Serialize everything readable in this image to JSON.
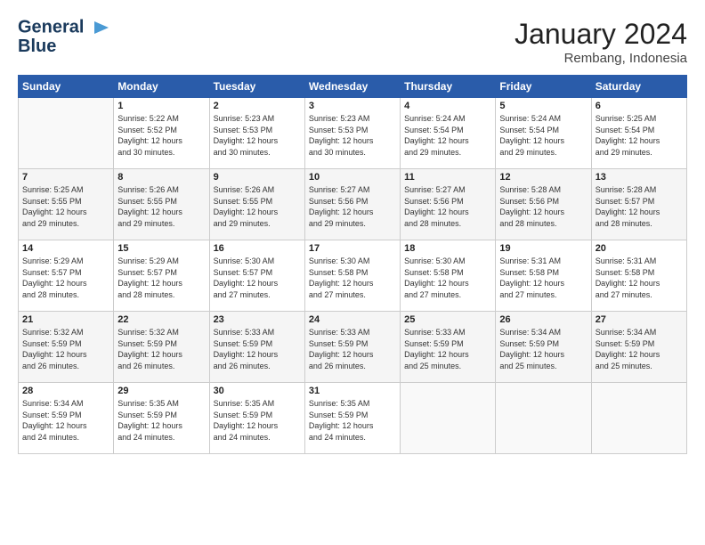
{
  "header": {
    "logo_line1": "General",
    "logo_line2": "Blue",
    "month_year": "January 2024",
    "location": "Rembang, Indonesia"
  },
  "days_of_week": [
    "Sunday",
    "Monday",
    "Tuesday",
    "Wednesday",
    "Thursday",
    "Friday",
    "Saturday"
  ],
  "weeks": [
    [
      {
        "day": "",
        "info": ""
      },
      {
        "day": "1",
        "info": "Sunrise: 5:22 AM\nSunset: 5:52 PM\nDaylight: 12 hours\nand 30 minutes."
      },
      {
        "day": "2",
        "info": "Sunrise: 5:23 AM\nSunset: 5:53 PM\nDaylight: 12 hours\nand 30 minutes."
      },
      {
        "day": "3",
        "info": "Sunrise: 5:23 AM\nSunset: 5:53 PM\nDaylight: 12 hours\nand 30 minutes."
      },
      {
        "day": "4",
        "info": "Sunrise: 5:24 AM\nSunset: 5:54 PM\nDaylight: 12 hours\nand 29 minutes."
      },
      {
        "day": "5",
        "info": "Sunrise: 5:24 AM\nSunset: 5:54 PM\nDaylight: 12 hours\nand 29 minutes."
      },
      {
        "day": "6",
        "info": "Sunrise: 5:25 AM\nSunset: 5:54 PM\nDaylight: 12 hours\nand 29 minutes."
      }
    ],
    [
      {
        "day": "7",
        "info": "Sunrise: 5:25 AM\nSunset: 5:55 PM\nDaylight: 12 hours\nand 29 minutes."
      },
      {
        "day": "8",
        "info": "Sunrise: 5:26 AM\nSunset: 5:55 PM\nDaylight: 12 hours\nand 29 minutes."
      },
      {
        "day": "9",
        "info": "Sunrise: 5:26 AM\nSunset: 5:55 PM\nDaylight: 12 hours\nand 29 minutes."
      },
      {
        "day": "10",
        "info": "Sunrise: 5:27 AM\nSunset: 5:56 PM\nDaylight: 12 hours\nand 29 minutes."
      },
      {
        "day": "11",
        "info": "Sunrise: 5:27 AM\nSunset: 5:56 PM\nDaylight: 12 hours\nand 28 minutes."
      },
      {
        "day": "12",
        "info": "Sunrise: 5:28 AM\nSunset: 5:56 PM\nDaylight: 12 hours\nand 28 minutes."
      },
      {
        "day": "13",
        "info": "Sunrise: 5:28 AM\nSunset: 5:57 PM\nDaylight: 12 hours\nand 28 minutes."
      }
    ],
    [
      {
        "day": "14",
        "info": "Sunrise: 5:29 AM\nSunset: 5:57 PM\nDaylight: 12 hours\nand 28 minutes."
      },
      {
        "day": "15",
        "info": "Sunrise: 5:29 AM\nSunset: 5:57 PM\nDaylight: 12 hours\nand 28 minutes."
      },
      {
        "day": "16",
        "info": "Sunrise: 5:30 AM\nSunset: 5:57 PM\nDaylight: 12 hours\nand 27 minutes."
      },
      {
        "day": "17",
        "info": "Sunrise: 5:30 AM\nSunset: 5:58 PM\nDaylight: 12 hours\nand 27 minutes."
      },
      {
        "day": "18",
        "info": "Sunrise: 5:30 AM\nSunset: 5:58 PM\nDaylight: 12 hours\nand 27 minutes."
      },
      {
        "day": "19",
        "info": "Sunrise: 5:31 AM\nSunset: 5:58 PM\nDaylight: 12 hours\nand 27 minutes."
      },
      {
        "day": "20",
        "info": "Sunrise: 5:31 AM\nSunset: 5:58 PM\nDaylight: 12 hours\nand 27 minutes."
      }
    ],
    [
      {
        "day": "21",
        "info": "Sunrise: 5:32 AM\nSunset: 5:59 PM\nDaylight: 12 hours\nand 26 minutes."
      },
      {
        "day": "22",
        "info": "Sunrise: 5:32 AM\nSunset: 5:59 PM\nDaylight: 12 hours\nand 26 minutes."
      },
      {
        "day": "23",
        "info": "Sunrise: 5:33 AM\nSunset: 5:59 PM\nDaylight: 12 hours\nand 26 minutes."
      },
      {
        "day": "24",
        "info": "Sunrise: 5:33 AM\nSunset: 5:59 PM\nDaylight: 12 hours\nand 26 minutes."
      },
      {
        "day": "25",
        "info": "Sunrise: 5:33 AM\nSunset: 5:59 PM\nDaylight: 12 hours\nand 25 minutes."
      },
      {
        "day": "26",
        "info": "Sunrise: 5:34 AM\nSunset: 5:59 PM\nDaylight: 12 hours\nand 25 minutes."
      },
      {
        "day": "27",
        "info": "Sunrise: 5:34 AM\nSunset: 5:59 PM\nDaylight: 12 hours\nand 25 minutes."
      }
    ],
    [
      {
        "day": "28",
        "info": "Sunrise: 5:34 AM\nSunset: 5:59 PM\nDaylight: 12 hours\nand 24 minutes."
      },
      {
        "day": "29",
        "info": "Sunrise: 5:35 AM\nSunset: 5:59 PM\nDaylight: 12 hours\nand 24 minutes."
      },
      {
        "day": "30",
        "info": "Sunrise: 5:35 AM\nSunset: 5:59 PM\nDaylight: 12 hours\nand 24 minutes."
      },
      {
        "day": "31",
        "info": "Sunrise: 5:35 AM\nSunset: 5:59 PM\nDaylight: 12 hours\nand 24 minutes."
      },
      {
        "day": "",
        "info": ""
      },
      {
        "day": "",
        "info": ""
      },
      {
        "day": "",
        "info": ""
      }
    ]
  ]
}
